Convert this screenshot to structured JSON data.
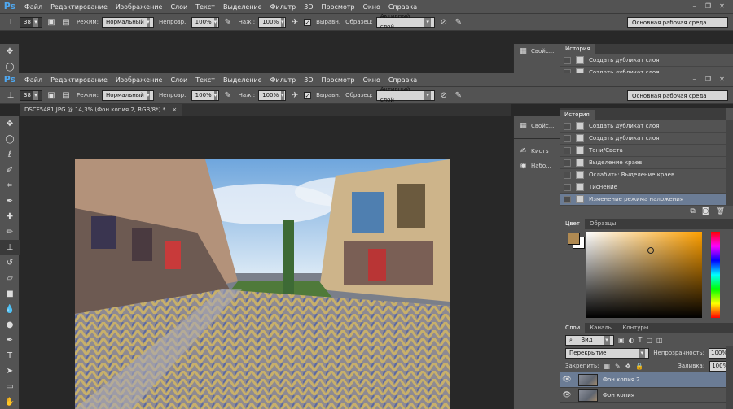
{
  "app": {
    "logo": "Ps"
  },
  "menu": [
    "Файл",
    "Редактирование",
    "Изображение",
    "Слои",
    "Текст",
    "Выделение",
    "Фильтр",
    "3D",
    "Просмотр",
    "Окно",
    "Справка"
  ],
  "window_controls": {
    "minimize": "–",
    "restore": "❐",
    "close": "✕"
  },
  "options": {
    "brush_size": "38",
    "mode_label": "Режим:",
    "mode_value": "Нормальный",
    "opacity_label": "Непрозр.:",
    "opacity_value": "100%",
    "pressure_label": "Наж.:",
    "pressure_value": "100%",
    "aligned_label": "Выравн.",
    "sample_label": "Образец:",
    "sample_value": "Активный слой",
    "workspace": "Основная рабочая среда"
  },
  "document": {
    "tab": "DSCF5481.JPG @ 14,3% (Фон копия 2, RGB/8*) *",
    "close": "×"
  },
  "mini_panel": {
    "properties": "Свойс...",
    "brush": "Кисть",
    "brush_sets": "Набо..."
  },
  "history_top": {
    "tab": "История",
    "rows": [
      "Создать дубликат слоя",
      "Создать дубликат слоя"
    ]
  },
  "history": {
    "tab": "История",
    "rows": [
      "Создать дубликат слоя",
      "Создать дубликат слоя",
      "Тени/Света",
      "Выделение краев",
      "Ослабить: Выделение краев",
      "Тиснение",
      "Изменение режима наложения"
    ],
    "selected_index": 6
  },
  "color_panel": {
    "tabs": [
      "Цвет",
      "Образцы"
    ],
    "fg_color": "#b08a52",
    "bg_color": "#ffffff",
    "hue": "#ffa000"
  },
  "layers_panel": {
    "tabs": [
      "Слои",
      "Каналы",
      "Контуры"
    ],
    "filter_label": "Вид",
    "blend_mode": "Перекрытие",
    "opacity_label": "Непрозрачность:",
    "opacity_value": "100%",
    "lock_label": "Закрепить:",
    "fill_label": "Заливка:",
    "fill_value": "100%",
    "layers": [
      "Фон копия 2",
      "Фон копия"
    ],
    "selected_index": 0
  }
}
